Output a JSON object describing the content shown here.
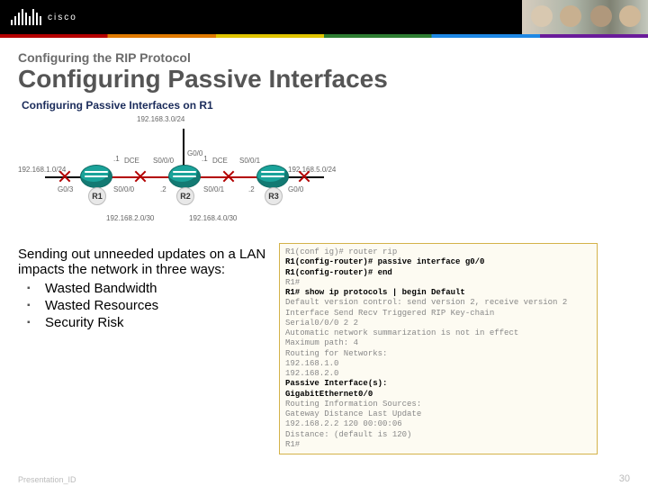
{
  "brand": "cisco",
  "eyebrow": "Configuring the RIP Protocol",
  "title": "Configuring Passive Interfaces",
  "diagram": {
    "title": "Configuring Passive Interfaces on R1",
    "nets": {
      "top": "192.168.3.0/24",
      "left": "192.168.1.0/24",
      "mid1": "192.168.2.0/30",
      "mid2": "192.168.4.0/30",
      "right": "192.168.5.0/24"
    },
    "r1": "R1",
    "r2": "R2",
    "r3": "R3",
    "labels": {
      "g00": "G0/0",
      "g03": "G0/3",
      "s000": "S0/0/0",
      "s001": "S0/0/1",
      "dce": "DCE",
      "d1": ".1",
      "d2": ".2"
    }
  },
  "impact": {
    "lead": "Sending out unneeded updates on a LAN impacts the network in three ways:",
    "items": [
      "Wasted Bandwidth",
      "Wasted Resources",
      "Security Risk"
    ]
  },
  "cli": {
    "l1": "R1(conf ig)# router rip",
    "l2": "R1(config-router)# passive interface g0/0",
    "l3": "R1(config-router)# end",
    "l4": "R1#",
    "l5": "R1# show ip protocols | begin Default",
    "l6": "Default version control: send version 2, receive version 2",
    "l7": "  Interface           Send  Recv  Triggered RIP  Key-chain",
    "l8": "  Serial0/0/0            2     2",
    "l9": "Automatic network summarization is not in effect",
    "l10": "Maximum path: 4",
    "l11": "Routing for Networks:",
    "l12": "  192.168.1.0",
    "l13": "  192.168.2.0",
    "l14": "Passive Interface(s):",
    "l15": "  GigabitEthernet0/0",
    "l16": "Routing Information Sources:",
    "l17": "  Gateway         Distance      Last Update",
    "l18": "  192.168.2.2          120      00:00:06",
    "l19": "Distance: (default is 120)",
    "l20": "",
    "l21": "R1#"
  },
  "footer": {
    "id": "Presentation_ID",
    "page": "30"
  }
}
